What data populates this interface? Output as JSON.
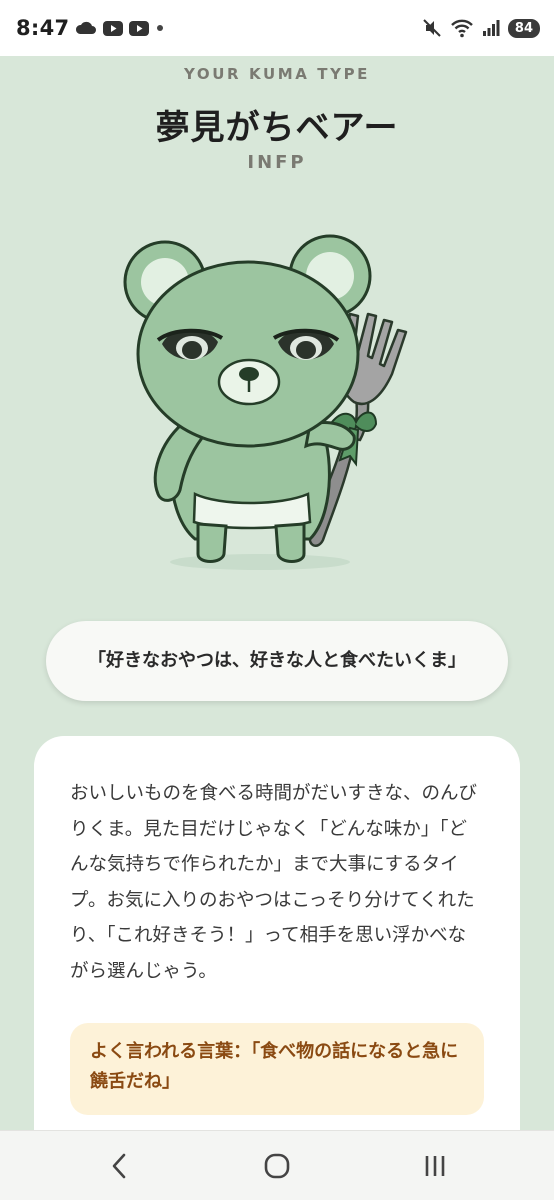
{
  "status_bar": {
    "time": "8:47",
    "left_icons": [
      "cloud-icon",
      "youtube-icon",
      "youtube-icon",
      "dot-icon"
    ],
    "right_icons": [
      "mute-icon",
      "wifi-icon",
      "signal-icon"
    ],
    "battery": "84"
  },
  "result": {
    "caption": "YOUR KUMA TYPE",
    "title": "夢見がちベアー",
    "code": "INFP",
    "image": "bear-with-fork-illustration",
    "quote": "「好きなおやつは、好きな人と食べたいくま」",
    "description": "おいしいものを食べる時間がだいすきな、のんびりくま。見た目だけじゃなく「どんな味か」「どんな気持ちで作られたか」まで大事にするタイプ。お気に入りのおやつはこっそり分けてくれたり、「これ好きそう！」って相手を思い浮かべながら選んじゃう。",
    "phrase": "よく言われる言葉：「食べ物の話になると急に饒舌だね」"
  },
  "nav_bar": {
    "buttons": [
      "back-icon",
      "home-icon",
      "recents-icon"
    ]
  },
  "colors": {
    "background": "#d8e7d9",
    "bear_body": "#9cc5a0",
    "card": "#ffffff",
    "phrase_bg": "#fdf2d8",
    "phrase_text": "#8a4a12"
  }
}
